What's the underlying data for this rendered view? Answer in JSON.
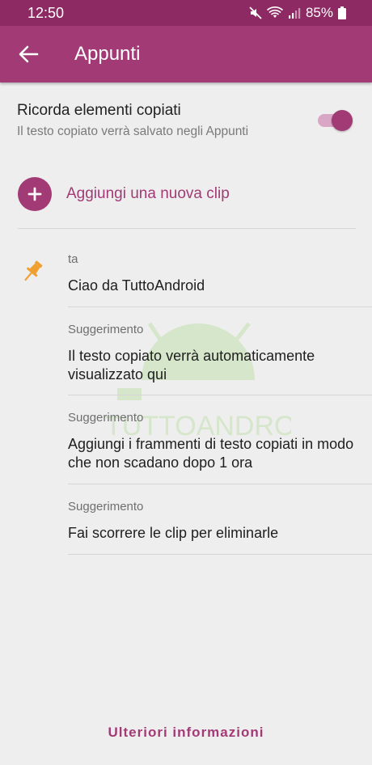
{
  "status": {
    "time": "12:50",
    "battery": "85%"
  },
  "appbar": {
    "title": "Appunti"
  },
  "setting": {
    "title": "Ricorda elementi copiati",
    "subtitle": "Il testo copiato verrà salvato negli Appunti",
    "enabled": true
  },
  "add_clip": {
    "label": "Aggiungi una nuova clip"
  },
  "clips": [
    {
      "label": "ta",
      "text": "Ciao da TuttoAndroid",
      "pinned": true
    },
    {
      "label": "Suggerimento",
      "text": "Il testo copiato verrà automaticamente visualizzato qui"
    },
    {
      "label": "Suggerimento",
      "text": "Aggiungi i frammenti di testo copiati in modo che non scadano dopo 1 ora"
    },
    {
      "label": "Suggerimento",
      "text": "Fai scorrere le clip per eliminarle"
    }
  ],
  "footer": {
    "more_label": "Ulteriori informazioni"
  },
  "watermark": {
    "text": "TUTTOANDROID"
  },
  "colors": {
    "accent": "#a23a76",
    "statusbar": "#8e2a63",
    "pin": "#f0a030"
  }
}
